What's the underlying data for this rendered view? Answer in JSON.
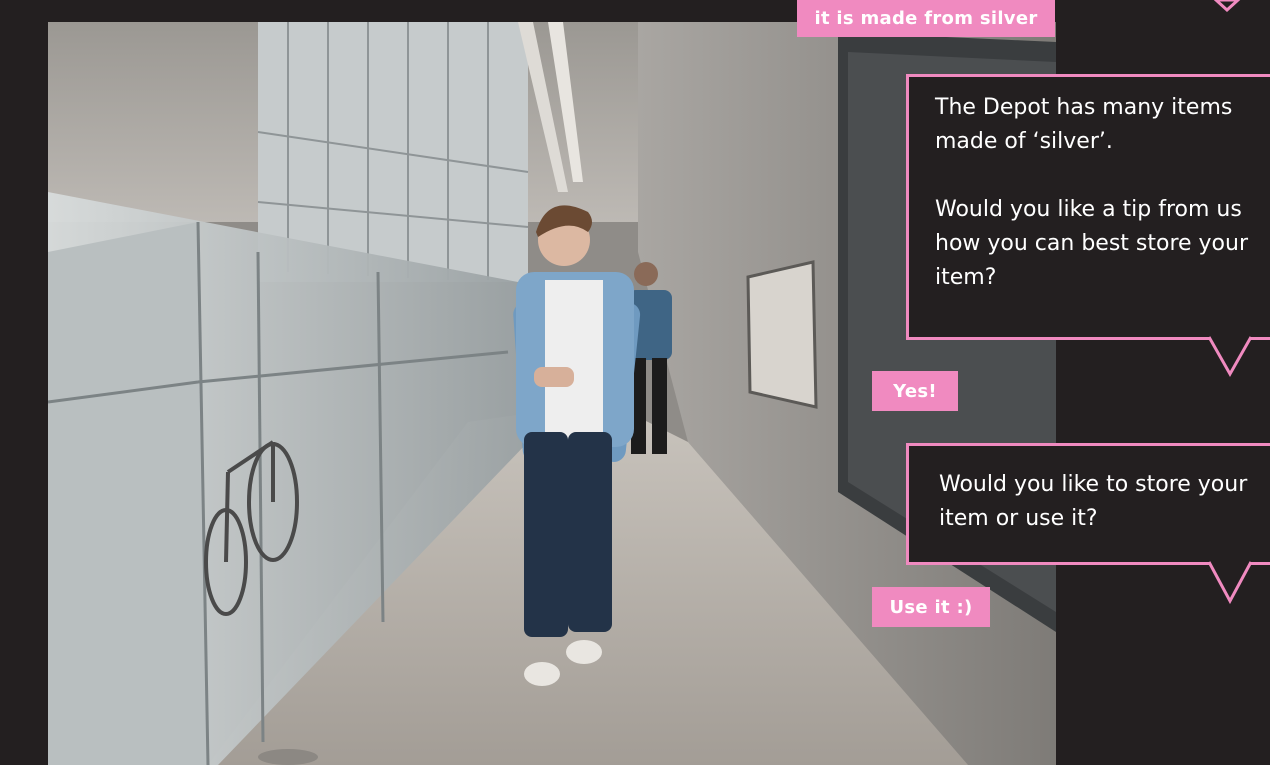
{
  "conversation": {
    "top_reply": "it is made from silver",
    "bot_message_1": "The Depot has many items made of ‘silver’.\n\nWould you like a tip from us how you can best store your item?",
    "reply_1": "Yes!",
    "bot_message_2": "Would you like to store your item or use it?",
    "reply_2": "Use it :)"
  },
  "colors": {
    "background": "#231f20",
    "accent_pink": "#f08ac0",
    "text": "#ffffff"
  },
  "photo": {
    "icon": "museum-corridor-photo"
  }
}
